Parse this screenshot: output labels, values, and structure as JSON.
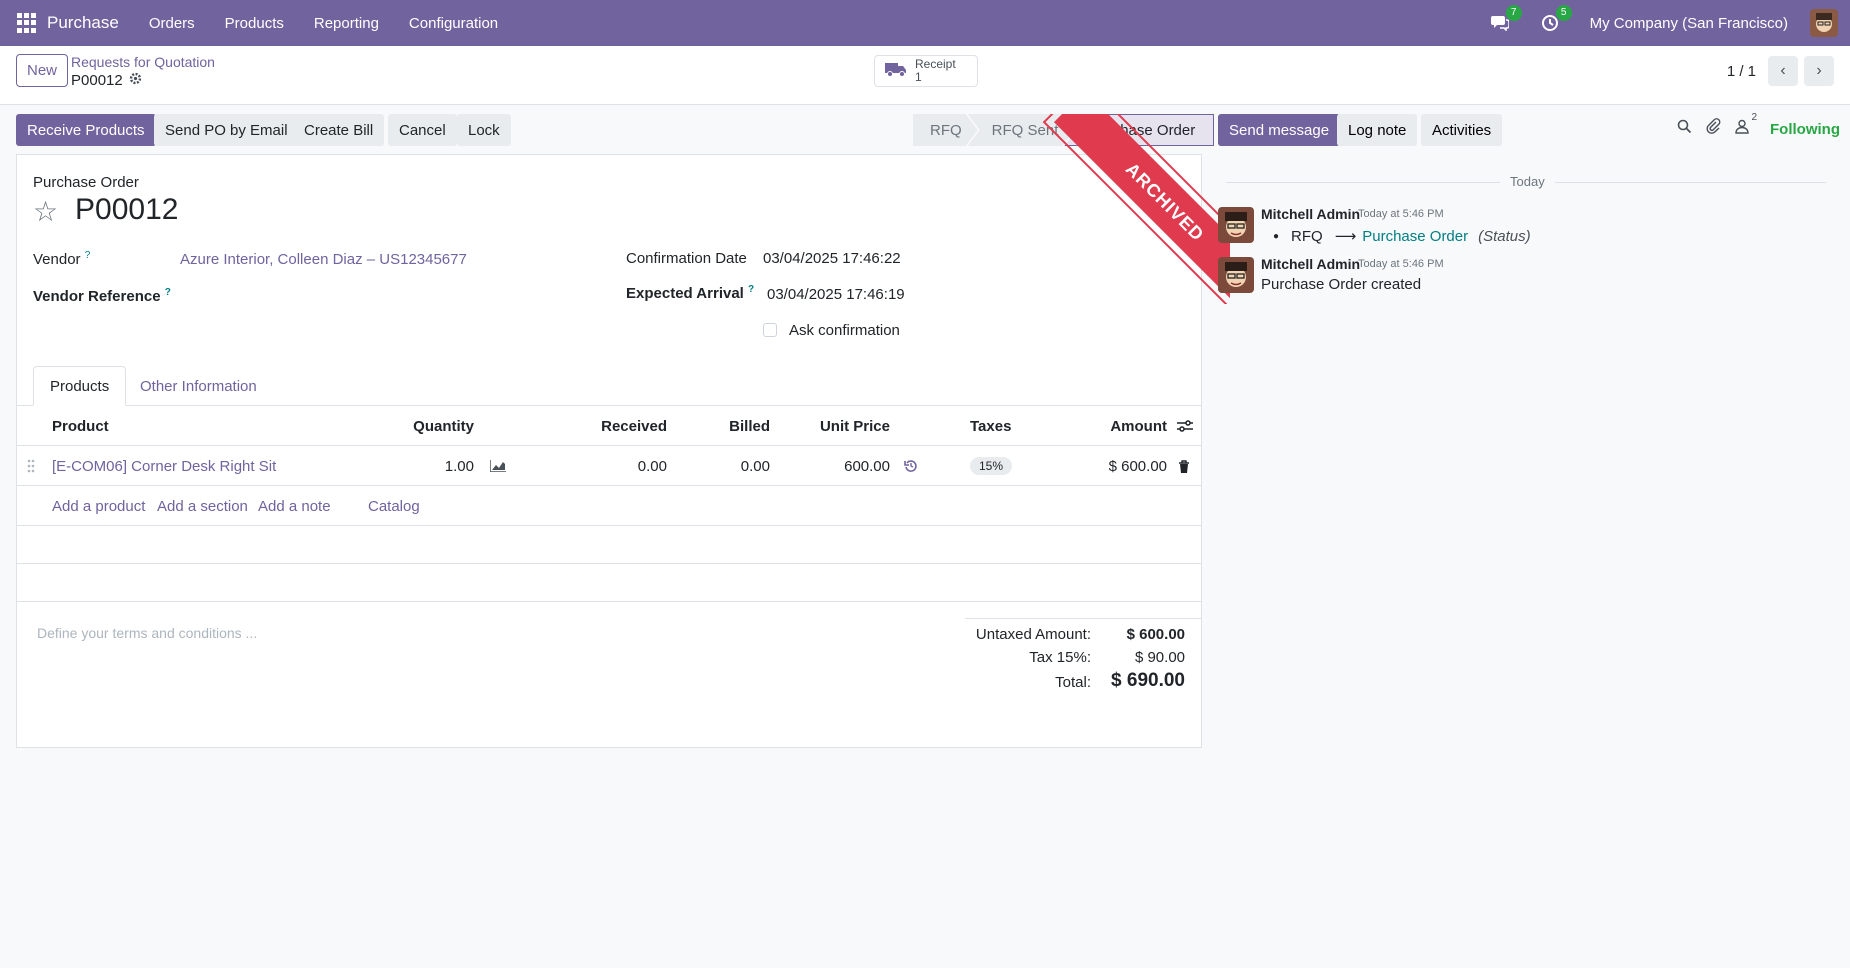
{
  "topbar": {
    "app_name": "Purchase",
    "menu": [
      "Orders",
      "Products",
      "Reporting",
      "Configuration"
    ],
    "messages_count": "7",
    "activities_count": "5",
    "company": "My Company (San Francisco)"
  },
  "control_panel": {
    "new_label": "New",
    "breadcrumb": "Requests for Quotation",
    "record": "P00012",
    "receipt_label": "Receipt",
    "receipt_count": "1",
    "pager": "1 / 1"
  },
  "actions": {
    "receive": "Receive Products",
    "send_email": "Send PO by Email",
    "create_bill": "Create Bill",
    "cancel": "Cancel",
    "lock": "Lock"
  },
  "stages": [
    "RFQ",
    "RFQ Sent",
    "Purchase Order"
  ],
  "ribbon": "ARCHIVED",
  "form": {
    "subtitle": "Purchase Order",
    "name": "P00012",
    "vendor_label": "Vendor",
    "vendor_value": "Azure Interior, Colleen Diaz – US12345677",
    "vendor_ref_label": "Vendor Reference",
    "confirm_label": "Confirmation Date",
    "confirm_value": "03/04/2025 17:46:22",
    "arrival_label": "Expected Arrival",
    "arrival_value": "03/04/2025 17:46:19",
    "ask_confirm": "Ask confirmation",
    "help_mark": "?"
  },
  "tabs": [
    "Products",
    "Other Information"
  ],
  "table": {
    "headers": {
      "product": "Product",
      "quantity": "Quantity",
      "received": "Received",
      "billed": "Billed",
      "unit_price": "Unit Price",
      "taxes": "Taxes",
      "amount": "Amount"
    },
    "row": {
      "product": "[E-COM06] Corner Desk Right Sit",
      "quantity": "1.00",
      "received": "0.00",
      "billed": "0.00",
      "unit_price": "600.00",
      "taxes": "15%",
      "amount": "$ 600.00"
    },
    "add_links": [
      "Add a product",
      "Add a section",
      "Add a note",
      "Catalog"
    ]
  },
  "terms_placeholder": "Define your terms and conditions ...",
  "totals": {
    "untaxed_label": "Untaxed Amount:",
    "untaxed_value": "$ 600.00",
    "tax_label": "Tax 15%:",
    "tax_value": "$ 90.00",
    "total_label": "Total:",
    "total_value": "$ 690.00"
  },
  "chatter": {
    "send_message": "Send message",
    "log_note": "Log note",
    "activities": "Activities",
    "followers_count": "2",
    "following": "Following",
    "today": "Today",
    "messages": [
      {
        "author": "Mitchell Admin",
        "time": "Today at 5:46 PM",
        "from": "RFQ",
        "arrow": "⟶",
        "to": "Purchase Order",
        "field": "(Status)"
      },
      {
        "author": "Mitchell Admin",
        "time": "Today at 5:46 PM",
        "text": "Purchase Order created"
      }
    ]
  },
  "colors": {
    "brand": "#71639e",
    "ribbon": "#e03a4e",
    "following": "#28a745",
    "link": "#017e84"
  }
}
